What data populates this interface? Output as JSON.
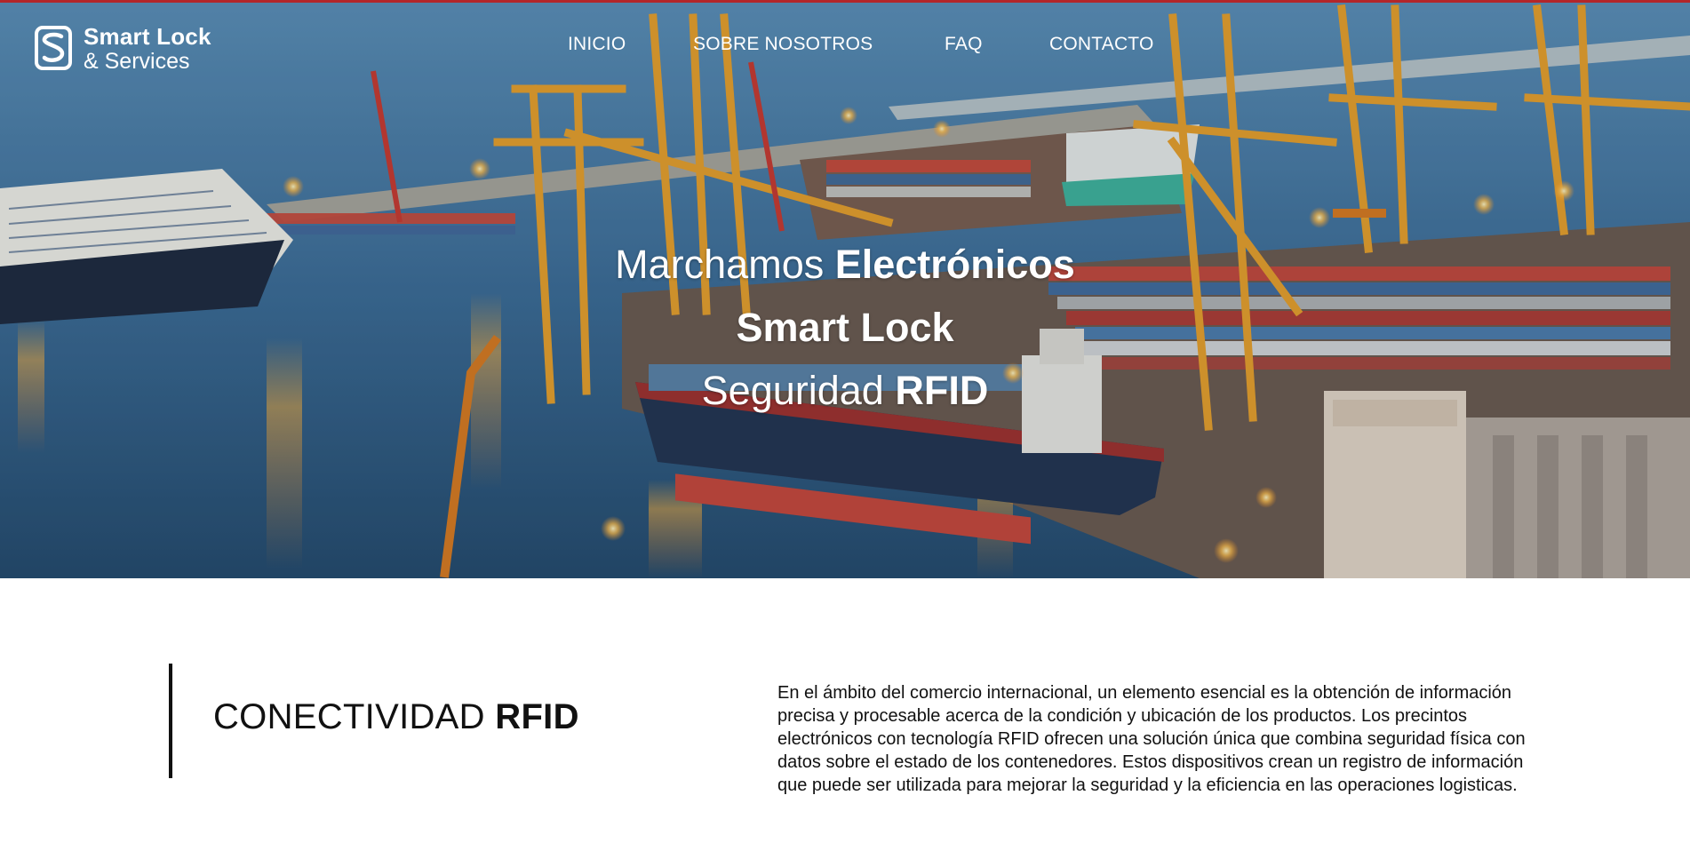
{
  "brand": {
    "name_line1": "Smart Lock",
    "name_line2": "& Services",
    "accent_color": "#b3262a"
  },
  "nav": {
    "items": [
      {
        "label": "INICIO"
      },
      {
        "label": "SOBRE NOSOTROS"
      },
      {
        "label": "FAQ"
      },
      {
        "label": "CONTACTO"
      }
    ]
  },
  "hero": {
    "line1_regular": "Marchamos ",
    "line1_bold": "Electrónicos",
    "line2_bold": "Smart Lock",
    "line3_regular": "Seguridad ",
    "line3_bold": "RFID",
    "background": "harbor-container-port-photo"
  },
  "section": {
    "title_regular": "CONECTIVIDAD ",
    "title_bold": "RFID",
    "body": "En el ámbito del comercio internacional, un elemento esencial es la obtención de información precisa y procesable acerca de la condición y ubicación de los productos. Los precintos electrónicos con tecnología RFID ofrecen una solución única que combina seguridad física con datos sobre el estado de los contenedores. Estos dispositivos crean un registro de información que puede ser utilizada para mejorar la seguridad y la eficiencia en las operaciones logisticas."
  }
}
